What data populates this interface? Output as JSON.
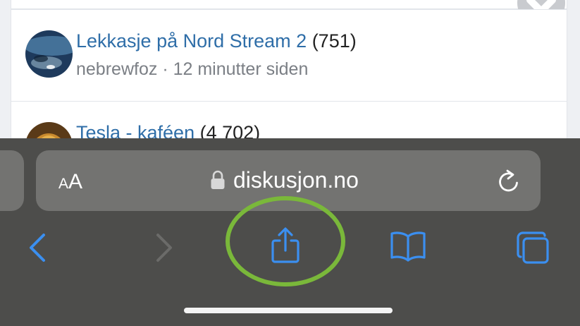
{
  "page": {
    "topics": [
      {
        "title": "Lekkasje på Nord Stream 2",
        "count": "(751)",
        "author": "nebrewfoz",
        "separator": "·",
        "time": "12 minutter siden",
        "avatar_color": "#1e3a5c"
      },
      {
        "title": "Tesla - kaféen",
        "count": "(4 702)",
        "avatar_color": "#5a3a18"
      }
    ],
    "link_color": "#2f6ea8"
  },
  "browser": {
    "address_bar": {
      "text_size_small": "A",
      "text_size_big": "A",
      "domain": "diskusjon.no",
      "lock_icon": "lock-icon",
      "reload_icon": "reload-icon"
    },
    "toolbar": {
      "back_icon": "chevron-left-icon",
      "forward_icon": "chevron-right-icon",
      "share_icon": "share-icon",
      "bookmarks_icon": "book-icon",
      "tabs_icon": "tabs-icon",
      "accent_color": "#3b8ff0",
      "disabled_color": "#6b6b69"
    },
    "annotation": {
      "highlight": "share-button",
      "ring_color": "#7ab83a"
    }
  }
}
